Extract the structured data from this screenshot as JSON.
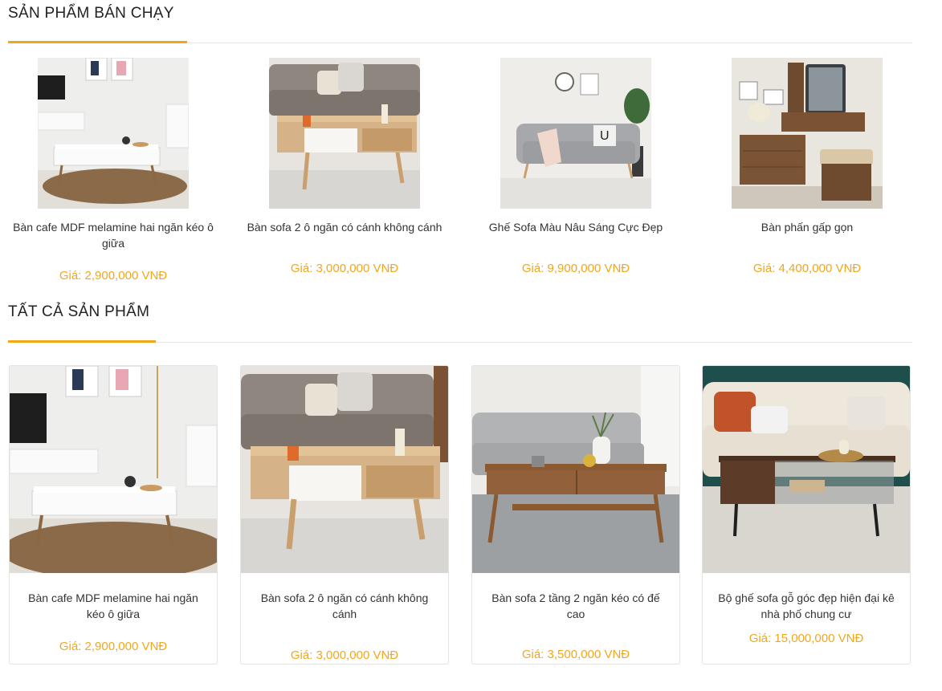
{
  "best_sellers": {
    "title": "SẢN PHẨM BÁN CHẠY",
    "items": [
      {
        "name": "Bàn cafe MDF melamine hai ngăn kéo ô giữa",
        "price": "Giá: 2,900,000 VNĐ",
        "image": "white-coffee-table-image"
      },
      {
        "name": "Bàn sofa 2 ô ngăn có cánh không cánh",
        "price": "Giá: 3,000,000 VNĐ",
        "image": "oak-sofa-table-image"
      },
      {
        "name": "Ghế Sofa Màu Nâu Sáng Cực Đẹp",
        "price": "Giá: 9,900,000 VNĐ",
        "image": "grey-sofa-image"
      },
      {
        "name": "Bàn phấn gấp gọn",
        "price": "Giá: 4,400,000 VNĐ",
        "image": "dressing-table-image"
      }
    ]
  },
  "all_products": {
    "title": "TẤT CẢ SẢN PHẨM",
    "items": [
      {
        "name": "Bàn cafe MDF melamine hai ngăn kéo ô giữa",
        "price": "Giá: 2,900,000 VNĐ",
        "image": "white-coffee-table-image"
      },
      {
        "name": "Bàn sofa 2 ô ngăn có cánh không cánh",
        "price": "Giá: 3,000,000 VNĐ",
        "image": "oak-sofa-table-image"
      },
      {
        "name": "Bàn sofa 2 tầng 2 ngăn kéo có đế cao",
        "price": "Giá: 3,500,000 VNĐ",
        "image": "walnut-two-tier-table-image"
      },
      {
        "name": "Bộ ghế sofa gỗ góc đẹp hiện đại kê nhà phố chung cư",
        "price": "Giá: 15,000,000 VNĐ",
        "image": "glass-top-table-sofa-image"
      }
    ]
  },
  "colors": {
    "accent": "#f2a71b",
    "text": "#333333",
    "border": "#e3e3e3"
  }
}
